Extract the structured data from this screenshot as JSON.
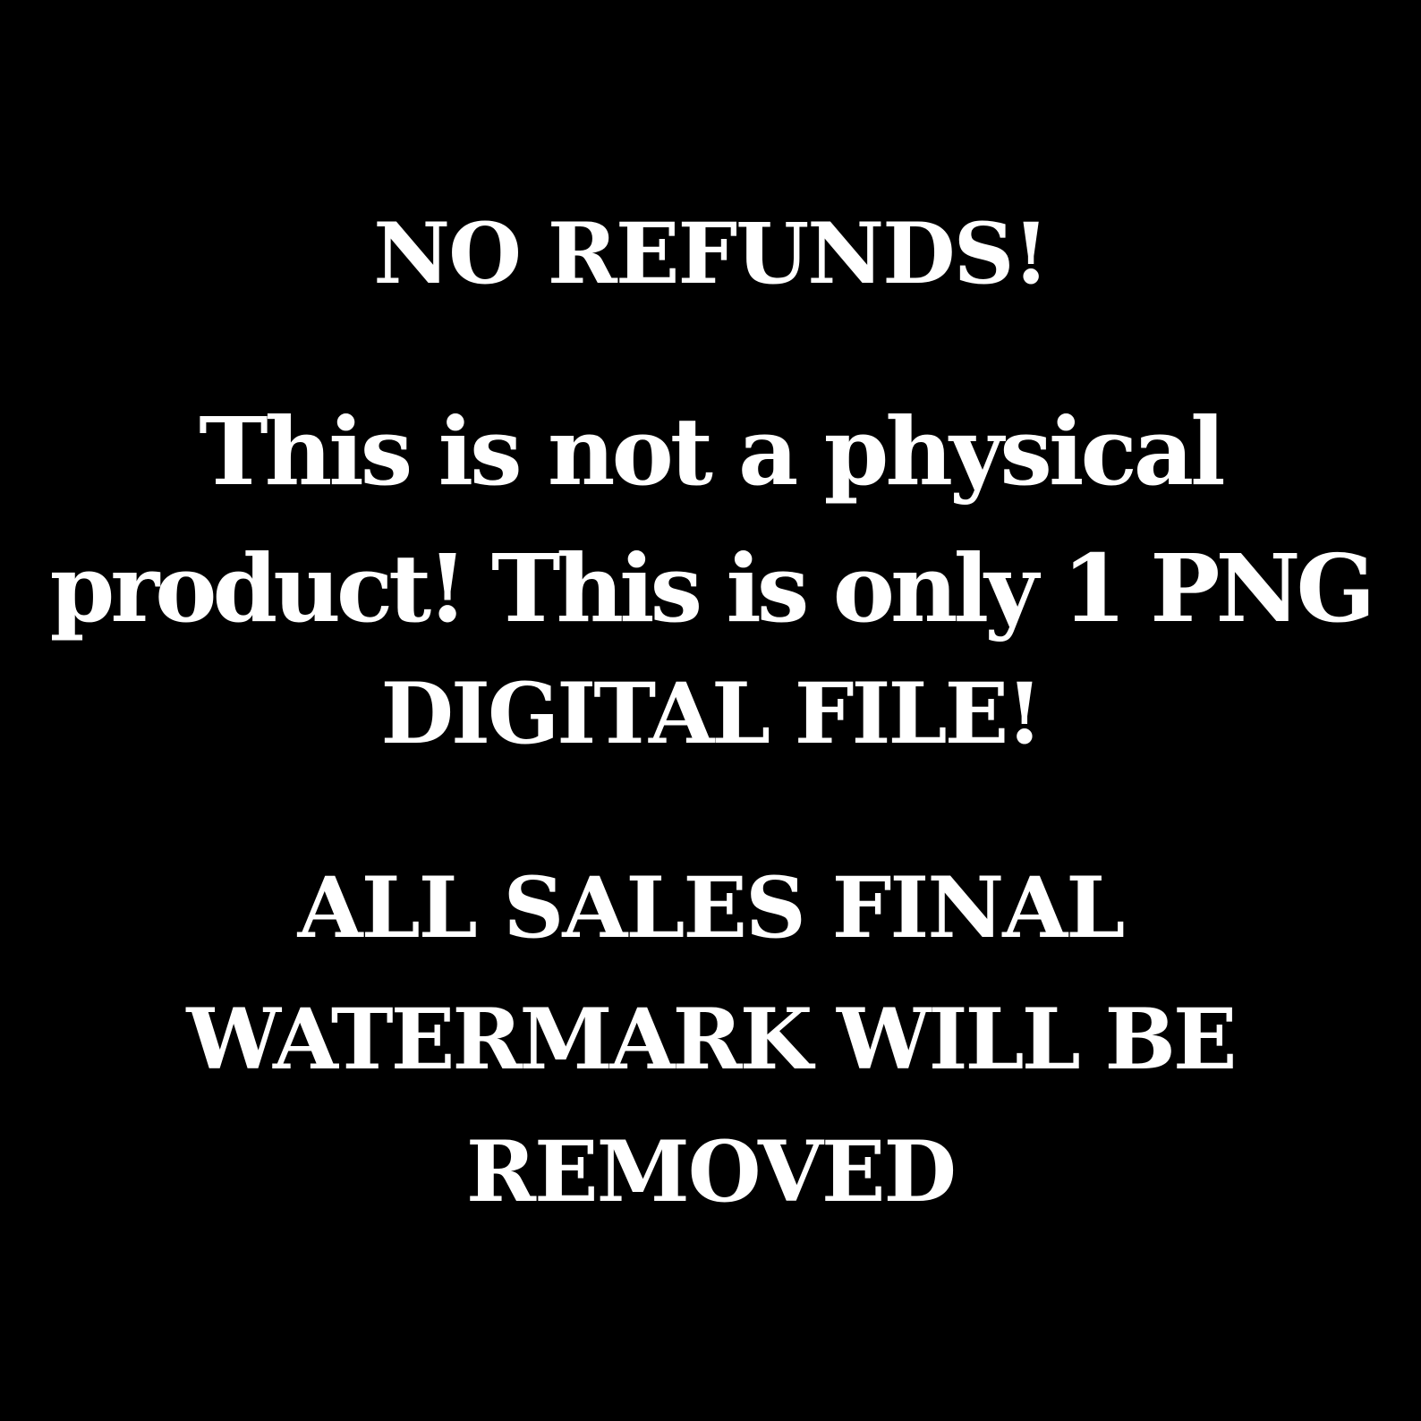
{
  "colors": {
    "background": "#000000",
    "text": "#ffffff"
  },
  "notice": {
    "heading": "NO REFUNDS!",
    "description_lines": [
      "This is not a physical",
      "product! This is only 1 PNG",
      "DIGITAL FILE!"
    ],
    "footer_lines": [
      "ALL SALES FINAL",
      "WATERMARK WILL BE",
      "REMOVED"
    ]
  }
}
